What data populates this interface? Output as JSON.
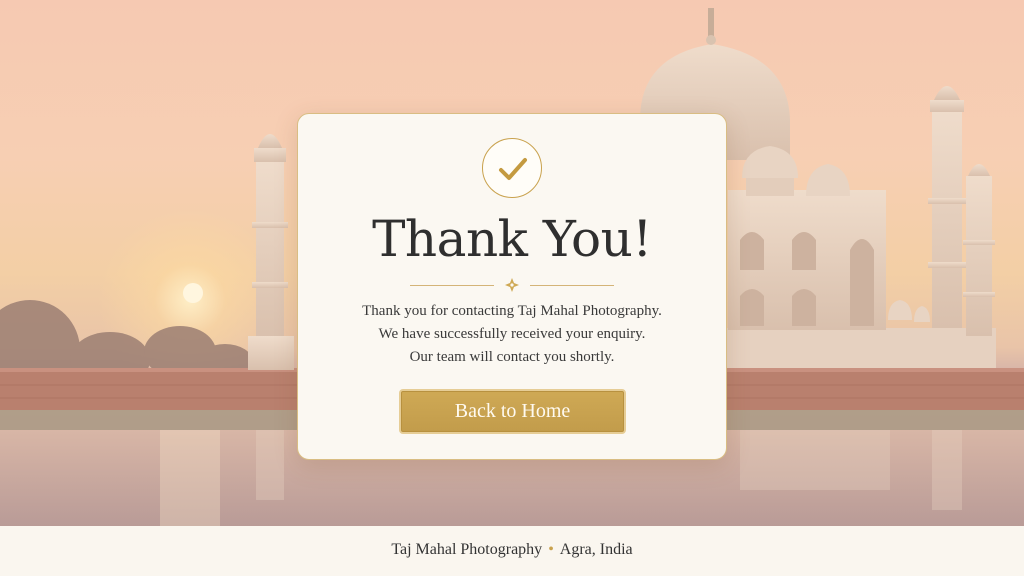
{
  "card": {
    "title": "Thank You!",
    "message_lines": [
      "Thank you for contacting Taj Mahal Photography.",
      "We have successfully received your enquiry.",
      "Our team will contact you shortly."
    ],
    "button_label": "Back to Home"
  },
  "footer": {
    "brand": "Taj Mahal Photography",
    "separator": "•",
    "location": "Agra, India"
  },
  "colors": {
    "accent_gold": "#c9a24e",
    "button_gold": "#c7a150",
    "card_bg": "#fbf8f2",
    "title_text": "#2f2f2f"
  },
  "icons": {
    "badge": "checkmark-icon",
    "divider": "ornament-icon",
    "footer_separator": "dot-icon"
  }
}
